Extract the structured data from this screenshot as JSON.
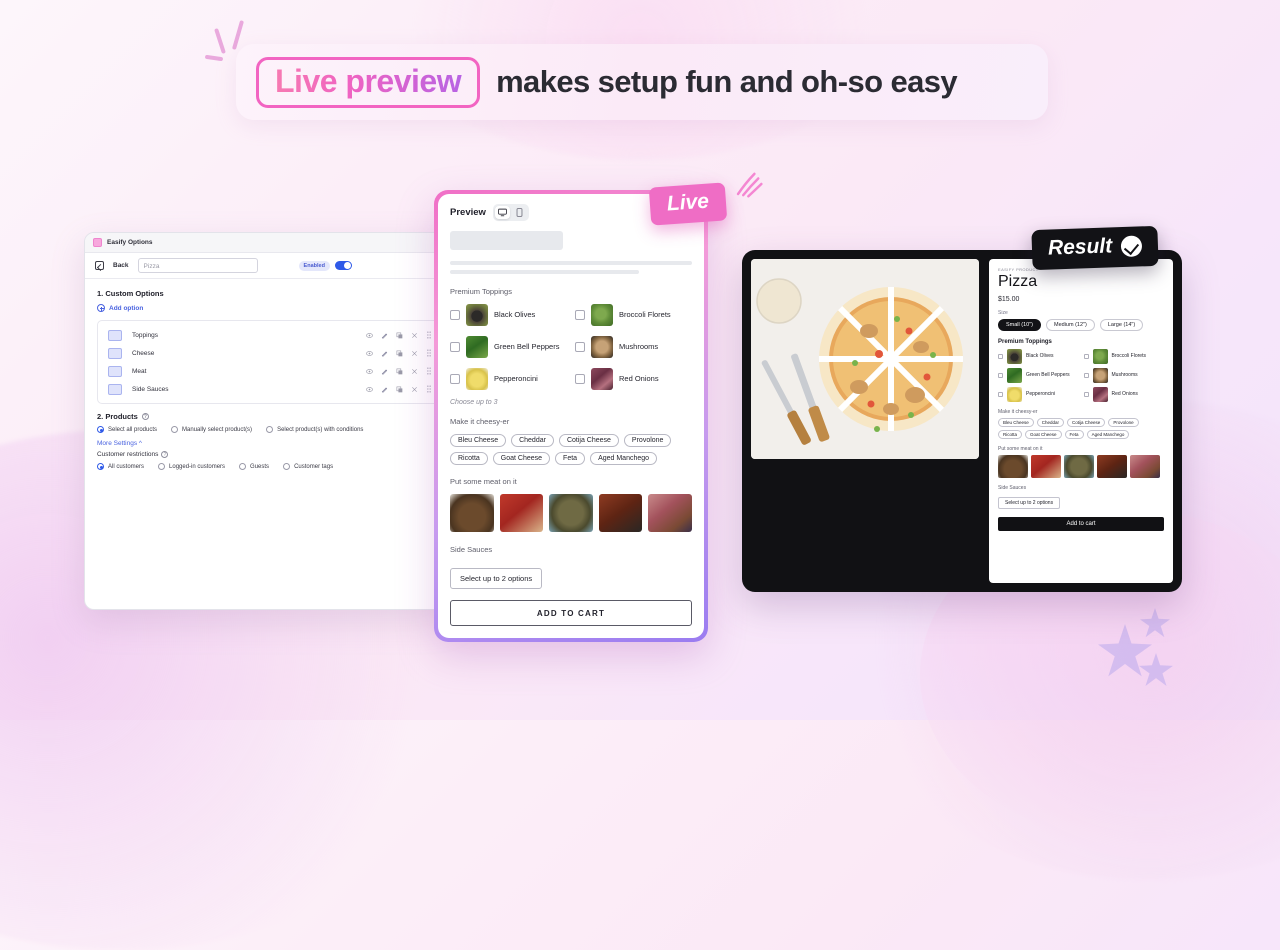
{
  "headline": {
    "chip": "Live preview",
    "rest": "makes setup fun and oh-so easy"
  },
  "badges": {
    "live": "Live",
    "result": "Result"
  },
  "admin": {
    "app_title": "Easify Options",
    "back_label": "Back",
    "product_name": "Pizza",
    "enabled_label": "Enabled",
    "section_custom_options": "1. Custom Options",
    "add_option": "Add option",
    "options": [
      {
        "label": "Toppings"
      },
      {
        "label": "Cheese"
      },
      {
        "label": "Meat"
      },
      {
        "label": "Side Sauces"
      }
    ],
    "row_actions": [
      "eye-icon",
      "pencil-icon",
      "duplicate-icon",
      "close-icon",
      "drag-handle-icon"
    ],
    "section_products": "2. Products",
    "product_radios": [
      {
        "label": "Select all products",
        "selected": true
      },
      {
        "label": "Manually select product(s)",
        "selected": false
      },
      {
        "label": "Select product(s) with conditions",
        "selected": false
      }
    ],
    "more_settings": "More Settings",
    "customer_restrictions": "Customer restrictions",
    "customer_radios": [
      {
        "label": "All customers",
        "selected": true
      },
      {
        "label": "Logged-in customers",
        "selected": false
      },
      {
        "label": "Guests",
        "selected": false
      },
      {
        "label": "Customer tags",
        "selected": false
      }
    ]
  },
  "preview": {
    "title": "Preview",
    "devices": [
      "desktop-icon",
      "mobile-icon"
    ],
    "active_device": "desktop-icon",
    "toppings_label": "Premium Toppings",
    "toppings": [
      {
        "name": "Black Olives"
      },
      {
        "name": "Broccoli Florets"
      },
      {
        "name": "Green Bell Peppers"
      },
      {
        "name": "Mushrooms"
      },
      {
        "name": "Pepperoncini"
      },
      {
        "name": "Red Onions"
      }
    ],
    "toppings_hint": "Choose up to 3",
    "cheese_label": "Make it cheesy-er",
    "cheeses": [
      "Bleu Cheese",
      "Cheddar",
      "Cotija Cheese",
      "Provolone",
      "Ricotta",
      "Goat Cheese",
      "Feta",
      "Aged Manchego"
    ],
    "meat_label": "Put some meat on it",
    "meats": [
      "ground-beef",
      "pepperoni",
      "anchovies",
      "bacon-strips",
      "salami"
    ],
    "sauces_label": "Side Sauces",
    "sauces_select": "Select up to 2 options",
    "add_to_cart": "ADD TO CART"
  },
  "result": {
    "vendor": "EASIFY PRODUCT",
    "title": "Pizza",
    "price": "$15.00",
    "size_label": "Size",
    "sizes": [
      {
        "label": "Small (10\")",
        "selected": true
      },
      {
        "label": "Medium (12\")",
        "selected": false
      },
      {
        "label": "Large (14\")",
        "selected": false
      }
    ],
    "toppings_label": "Premium Toppings",
    "toppings": [
      {
        "name": "Black Olives"
      },
      {
        "name": "Broccoli Florets"
      },
      {
        "name": "Green Bell Peppers"
      },
      {
        "name": "Mushrooms"
      },
      {
        "name": "Pepperoncini"
      },
      {
        "name": "Red Onions"
      }
    ],
    "cheese_label": "Make it cheesy-er",
    "cheeses": [
      "Bleu Cheese",
      "Cheddar",
      "Cotija Cheese",
      "Provolone",
      "Ricotta",
      "Goat Cheese",
      "Feta",
      "Aged Manchego"
    ],
    "meat_label": "Put some meat on it",
    "sauces_label": "Side Sauces",
    "sauces_select": "Select up to 2 options",
    "add_to_cart": "Add to cart"
  },
  "colors": {
    "brand_pink": "#ef6dc5",
    "accent_purple": "#9a7cf0",
    "admin_blue": "#2f5ae8",
    "dark": "#121216"
  }
}
